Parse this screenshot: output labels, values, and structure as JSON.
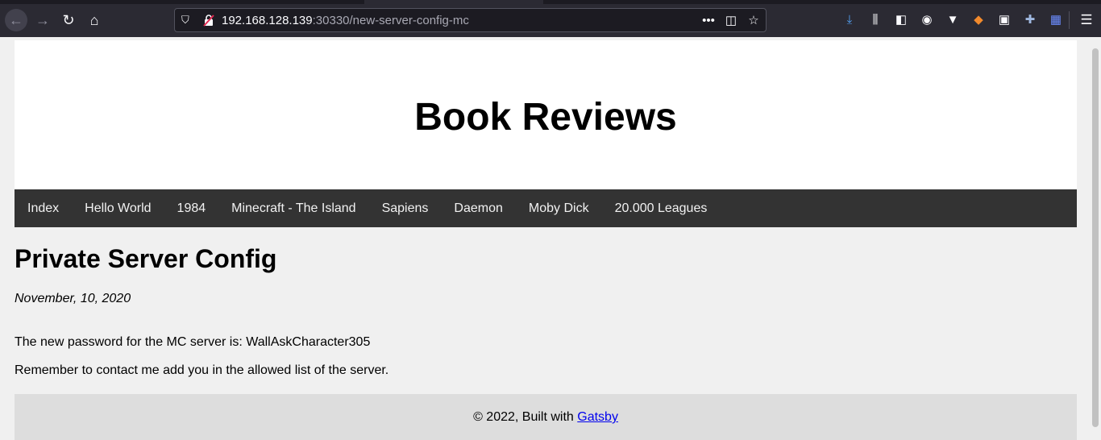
{
  "browser": {
    "url_host": "192.168.128.139",
    "url_rest": ":30330/new-server-config-mc"
  },
  "site": {
    "title": "Book Reviews",
    "nav": [
      "Index",
      "Hello World",
      "1984",
      "Minecraft - The Island",
      "Sapiens",
      "Daemon",
      "Moby Dick",
      "20.000 Leagues"
    ]
  },
  "post": {
    "title": "Private Server Config",
    "date": "November, 10, 2020",
    "paragraphs": [
      "The new password for the MC server is: WallAskCharacter305",
      "Remember to contact me add you in the allowed list of the server."
    ]
  },
  "footer": {
    "prefix": "© 2022, Built with ",
    "link": "Gatsby"
  }
}
